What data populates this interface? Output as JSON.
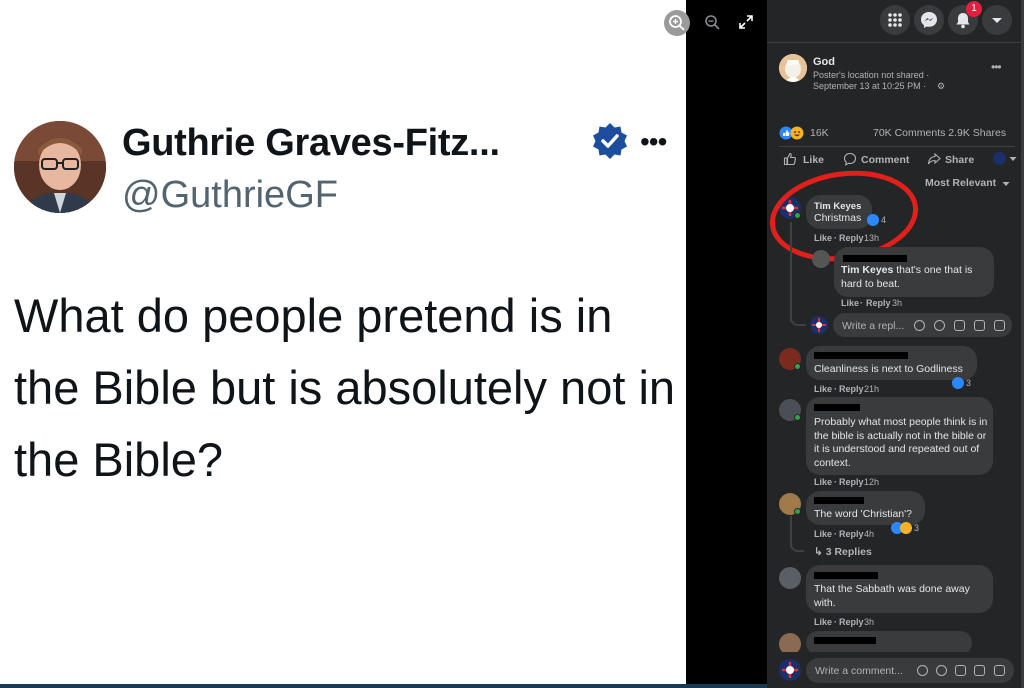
{
  "tweet": {
    "name": "Guthrie Graves-Fitz...",
    "handle": "@GuthrieGF",
    "more": "•••",
    "text": "What do people pretend is in the Bible but is absolutely not in the Bible?"
  },
  "topbar": {
    "notification_count": "1"
  },
  "post": {
    "author": "God",
    "location": "Poster's location not shared ·",
    "time": "September 13 at 10:25 PM ·",
    "more": "•••",
    "reactions_count": "16K",
    "comments_shares": "70K Comments 2.9K Shares",
    "like_label": "Like",
    "comment_label": "Comment",
    "share_label": "Share",
    "sort_label": "Most Relevant"
  },
  "comments": [
    {
      "name": "Tim Keyes",
      "text": "Christmas",
      "reaction_count": "4",
      "like": "Like",
      "reply": "Reply",
      "time": "13h"
    },
    {
      "name": "Tim Keyes",
      "text": "that's one that is",
      "text2": "hard to beat.",
      "like": "Like",
      "reply": "Reply",
      "time": "3h"
    },
    {
      "text": "Cleanliness is next to Godliness",
      "reaction_count": "3",
      "like": "Like",
      "reply": "Reply",
      "time": "21h"
    },
    {
      "text": "Probably what most people think is in the bible is actually not in the bible or it is understood and repeated out of context.",
      "like": "Like",
      "reply": "Reply",
      "time": "12h"
    },
    {
      "text": "The word 'Christian'?",
      "reaction_count": "3",
      "like": "Like",
      "reply": "Reply",
      "time": "4h",
      "replies": "3 Replies"
    },
    {
      "text": "That the Sabbath was done away with.",
      "like": "Like",
      "reply": "Reply",
      "time": "3h"
    }
  ],
  "reply_placeholder": "Write a repl...",
  "comment_placeholder": "Write a comment...",
  "colors": {
    "fb_bg": "#242526",
    "bubble": "#3a3b3c",
    "accent_blue": "#2d88ff",
    "red_circle": "#e0201b",
    "twitter_blue": "#1d4e9e"
  }
}
